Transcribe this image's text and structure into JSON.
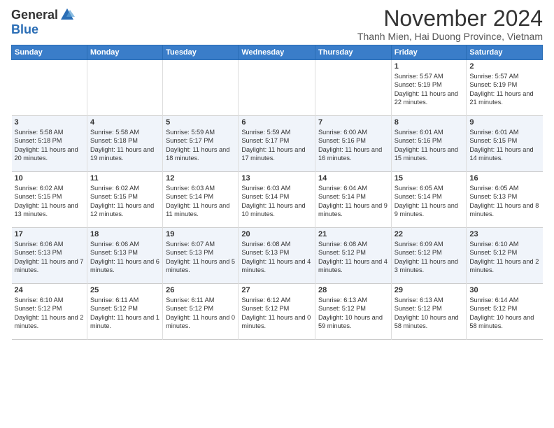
{
  "header": {
    "logo_general": "General",
    "logo_blue": "Blue",
    "title": "November 2024",
    "subtitle": "Thanh Mien, Hai Duong Province, Vietnam"
  },
  "calendar": {
    "weekdays": [
      "Sunday",
      "Monday",
      "Tuesday",
      "Wednesday",
      "Thursday",
      "Friday",
      "Saturday"
    ],
    "weeks": [
      [
        {
          "day": "",
          "info": ""
        },
        {
          "day": "",
          "info": ""
        },
        {
          "day": "",
          "info": ""
        },
        {
          "day": "",
          "info": ""
        },
        {
          "day": "",
          "info": ""
        },
        {
          "day": "1",
          "info": "Sunrise: 5:57 AM\nSunset: 5:19 PM\nDaylight: 11 hours\nand 22 minutes."
        },
        {
          "day": "2",
          "info": "Sunrise: 5:57 AM\nSunset: 5:19 PM\nDaylight: 11 hours\nand 21 minutes."
        }
      ],
      [
        {
          "day": "3",
          "info": "Sunrise: 5:58 AM\nSunset: 5:18 PM\nDaylight: 11 hours\nand 20 minutes."
        },
        {
          "day": "4",
          "info": "Sunrise: 5:58 AM\nSunset: 5:18 PM\nDaylight: 11 hours\nand 19 minutes."
        },
        {
          "day": "5",
          "info": "Sunrise: 5:59 AM\nSunset: 5:17 PM\nDaylight: 11 hours\nand 18 minutes."
        },
        {
          "day": "6",
          "info": "Sunrise: 5:59 AM\nSunset: 5:17 PM\nDaylight: 11 hours\nand 17 minutes."
        },
        {
          "day": "7",
          "info": "Sunrise: 6:00 AM\nSunset: 5:16 PM\nDaylight: 11 hours\nand 16 minutes."
        },
        {
          "day": "8",
          "info": "Sunrise: 6:01 AM\nSunset: 5:16 PM\nDaylight: 11 hours\nand 15 minutes."
        },
        {
          "day": "9",
          "info": "Sunrise: 6:01 AM\nSunset: 5:15 PM\nDaylight: 11 hours\nand 14 minutes."
        }
      ],
      [
        {
          "day": "10",
          "info": "Sunrise: 6:02 AM\nSunset: 5:15 PM\nDaylight: 11 hours\nand 13 minutes."
        },
        {
          "day": "11",
          "info": "Sunrise: 6:02 AM\nSunset: 5:15 PM\nDaylight: 11 hours\nand 12 minutes."
        },
        {
          "day": "12",
          "info": "Sunrise: 6:03 AM\nSunset: 5:14 PM\nDaylight: 11 hours\nand 11 minutes."
        },
        {
          "day": "13",
          "info": "Sunrise: 6:03 AM\nSunset: 5:14 PM\nDaylight: 11 hours\nand 10 minutes."
        },
        {
          "day": "14",
          "info": "Sunrise: 6:04 AM\nSunset: 5:14 PM\nDaylight: 11 hours\nand 9 minutes."
        },
        {
          "day": "15",
          "info": "Sunrise: 6:05 AM\nSunset: 5:14 PM\nDaylight: 11 hours\nand 9 minutes."
        },
        {
          "day": "16",
          "info": "Sunrise: 6:05 AM\nSunset: 5:13 PM\nDaylight: 11 hours\nand 8 minutes."
        }
      ],
      [
        {
          "day": "17",
          "info": "Sunrise: 6:06 AM\nSunset: 5:13 PM\nDaylight: 11 hours\nand 7 minutes."
        },
        {
          "day": "18",
          "info": "Sunrise: 6:06 AM\nSunset: 5:13 PM\nDaylight: 11 hours\nand 6 minutes."
        },
        {
          "day": "19",
          "info": "Sunrise: 6:07 AM\nSunset: 5:13 PM\nDaylight: 11 hours\nand 5 minutes."
        },
        {
          "day": "20",
          "info": "Sunrise: 6:08 AM\nSunset: 5:13 PM\nDaylight: 11 hours\nand 4 minutes."
        },
        {
          "day": "21",
          "info": "Sunrise: 6:08 AM\nSunset: 5:12 PM\nDaylight: 11 hours\nand 4 minutes."
        },
        {
          "day": "22",
          "info": "Sunrise: 6:09 AM\nSunset: 5:12 PM\nDaylight: 11 hours\nand 3 minutes."
        },
        {
          "day": "23",
          "info": "Sunrise: 6:10 AM\nSunset: 5:12 PM\nDaylight: 11 hours\nand 2 minutes."
        }
      ],
      [
        {
          "day": "24",
          "info": "Sunrise: 6:10 AM\nSunset: 5:12 PM\nDaylight: 11 hours\nand 2 minutes."
        },
        {
          "day": "25",
          "info": "Sunrise: 6:11 AM\nSunset: 5:12 PM\nDaylight: 11 hours\nand 1 minute."
        },
        {
          "day": "26",
          "info": "Sunrise: 6:11 AM\nSunset: 5:12 PM\nDaylight: 11 hours\nand 0 minutes."
        },
        {
          "day": "27",
          "info": "Sunrise: 6:12 AM\nSunset: 5:12 PM\nDaylight: 11 hours\nand 0 minutes."
        },
        {
          "day": "28",
          "info": "Sunrise: 6:13 AM\nSunset: 5:12 PM\nDaylight: 10 hours\nand 59 minutes."
        },
        {
          "day": "29",
          "info": "Sunrise: 6:13 AM\nSunset: 5:12 PM\nDaylight: 10 hours\nand 58 minutes."
        },
        {
          "day": "30",
          "info": "Sunrise: 6:14 AM\nSunset: 5:12 PM\nDaylight: 10 hours\nand 58 minutes."
        }
      ]
    ]
  }
}
